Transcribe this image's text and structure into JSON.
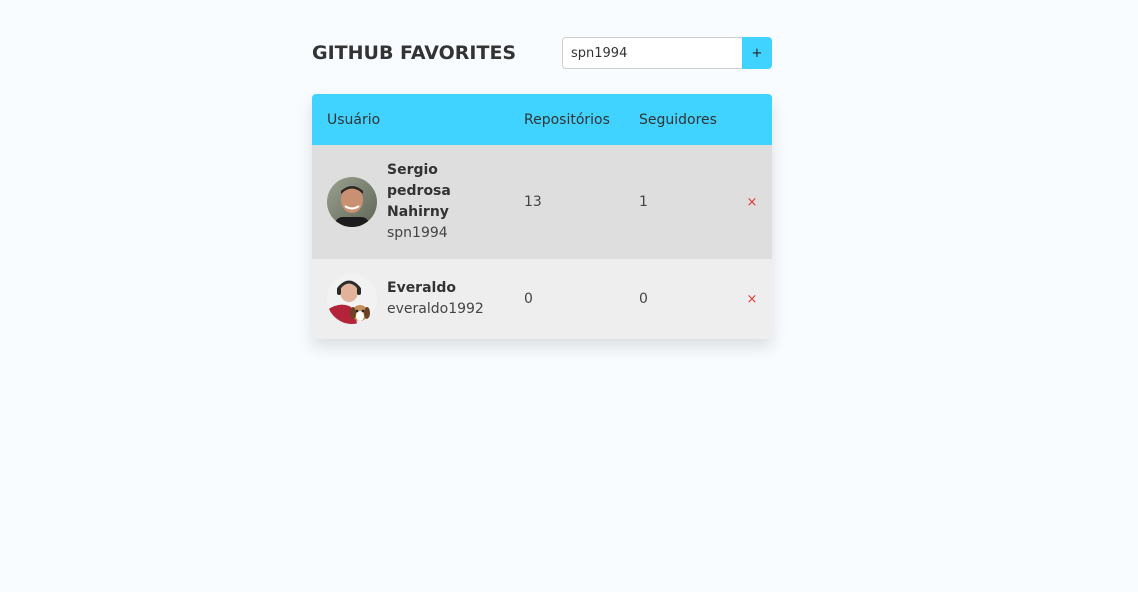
{
  "header": {
    "title": "GITHUB FAVORITES",
    "search": {
      "value": "spn1994",
      "placeholder": ""
    },
    "add_label": "+"
  },
  "table": {
    "columns": {
      "user": "Usuário",
      "repos": "Repositórios",
      "followers": "Seguidores"
    },
    "rows": [
      {
        "name": "Sergio pedrosa Nahirny",
        "login": "spn1994",
        "repos": "13",
        "followers": "1",
        "remove_label": "×",
        "avatar_icon": "avatar-man-photo"
      },
      {
        "name": "Everaldo",
        "login": "everaldo1992",
        "repos": "0",
        "followers": "0",
        "remove_label": "×",
        "avatar_icon": "avatar-man-with-dog-photo"
      }
    ]
  },
  "colors": {
    "accent": "#40d3ff",
    "row_odd": "#dedede",
    "row_even": "#eeeeee",
    "remove": "#e53935",
    "background": "#f9fcff"
  }
}
